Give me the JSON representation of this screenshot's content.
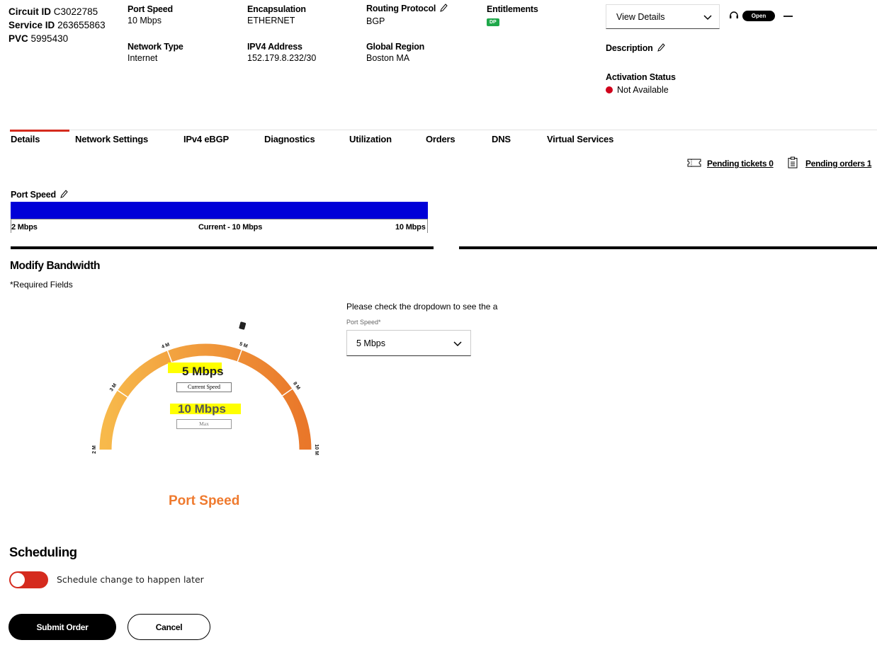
{
  "header": {
    "circuit_id_label": "Circuit ID",
    "circuit_id_value": "C3022785",
    "service_id_label": "Service ID",
    "service_id_value": "263655863",
    "pvc_label": "PVC",
    "pvc_value": "5995430",
    "port_speed_label": "Port Speed",
    "port_speed_value": "10 Mbps",
    "network_type_label": "Network Type",
    "network_type_value": "Internet",
    "encapsulation_label": "Encapsulation",
    "encapsulation_value": "ETHERNET",
    "ipv4_label": "IPV4 Address",
    "ipv4_value": "152.179.8.232/30",
    "routing_label": "Routing Protocol",
    "routing_value": "BGP",
    "region_label": "Global Region",
    "region_value": "Boston MA",
    "entitlements_label": "Entitlements",
    "entitlements_badge": "DP",
    "view_details": "View Details",
    "open_badge": "Open",
    "description_label": "Description",
    "activation_label": "Activation Status",
    "activation_value": "Not Available"
  },
  "tabs": [
    {
      "label": "Details",
      "active": true
    },
    {
      "label": "Network Settings"
    },
    {
      "label": "IPv4 eBGP"
    },
    {
      "label": "Diagnostics"
    },
    {
      "label": "Utilization"
    },
    {
      "label": "Orders"
    },
    {
      "label": "DNS"
    },
    {
      "label": "Virtual Services"
    }
  ],
  "pending": {
    "tickets": "Pending tickets 0",
    "orders": "Pending orders 1"
  },
  "port_speed_bar": {
    "title": "Port Speed",
    "min_label": "2 Mbps",
    "current_label": "Current - 10 Mbps",
    "max_label": "10 Mbps",
    "fill_fraction": 1.0
  },
  "modify": {
    "title": "Modify Bandwidth",
    "required": "*Required Fields",
    "dropdown_hint": "Please check the dropdown to see the a",
    "select_label": "Port Speed*",
    "select_value": "5 Mbps"
  },
  "gauge": {
    "ticks": [
      "2 M",
      "3 M",
      "4 M",
      "5 M",
      "8 M",
      "10 M"
    ],
    "current_value": "5 Mbps",
    "current_caption": "Current Speed",
    "max_value": "10 Mbps",
    "max_caption": "Max",
    "title": "Port Speed",
    "colors": {
      "start": "#f7b94b",
      "end": "#e9772a",
      "title": "#ef7a2e",
      "highlight": "#ffff00"
    }
  },
  "scheduling": {
    "title": "Scheduling",
    "toggle_label": "Schedule change to happen later"
  },
  "actions": {
    "submit": "Submit Order",
    "cancel": "Cancel"
  }
}
